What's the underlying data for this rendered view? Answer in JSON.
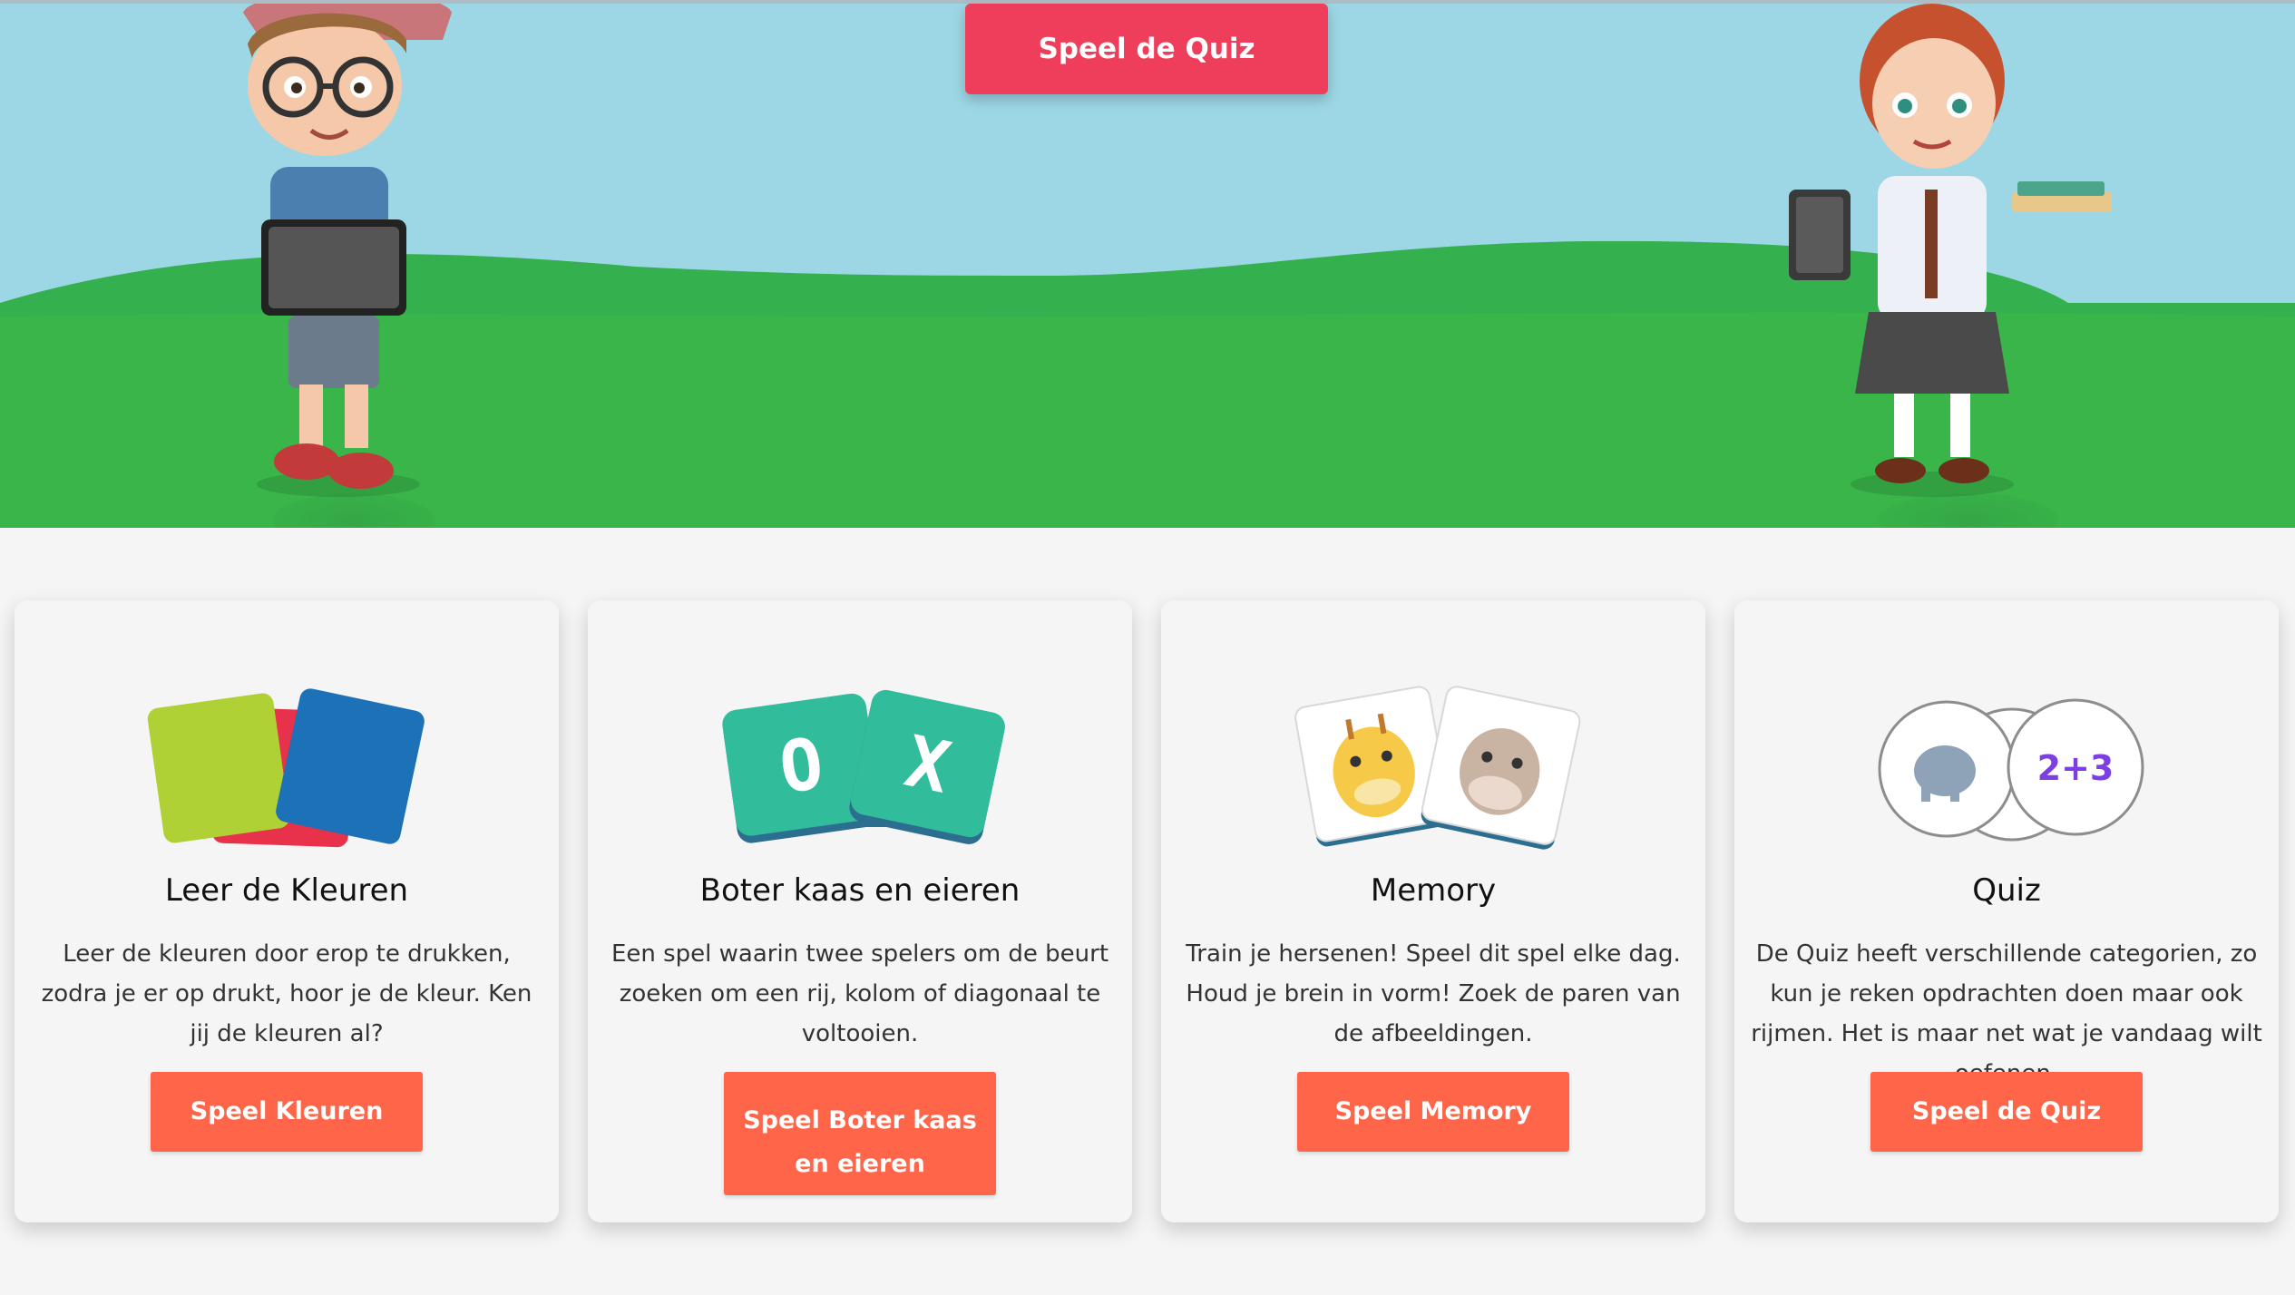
{
  "hero": {
    "cta_label": "Speel de Quiz",
    "colors": {
      "sky": "#9dd7e5",
      "grass_back": "#35b04e",
      "grass_front": "#39b54a",
      "cta": "#ef3e5c"
    }
  },
  "cards": [
    {
      "title": "Leer de Kleuren",
      "description": "Leer de kleuren door erop te drukken, zodra je er op drukt, hoor je de kleur. Ken jij de kleuren al?",
      "button": "Speel Kleuren",
      "icon": "color-cards-icon"
    },
    {
      "title": "Boter kaas en eieren",
      "description": "Een spel waarin twee spelers om de beurt zoeken om een rij, kolom of diagonaal te voltooien.",
      "button": "Speel Boter kaas en eieren",
      "icon": "tic-tac-toe-icon",
      "tiles": [
        "O",
        "X"
      ]
    },
    {
      "title": "Memory",
      "description": "Train je hersenen! Speel dit spel elke dag. Houd je brein in vorm! Zoek de paren van de afbeeldingen.",
      "button": "Speel Memory",
      "icon": "memory-cards-icon"
    },
    {
      "title": "Quiz",
      "description": "De Quiz heeft verschillende categorien, zo kun je reken opdrachten doen maar ook rijmen. Het is maar net wat je vandaag wilt oefenen.",
      "button": "Speel de Quiz",
      "icon": "quiz-circles-icon",
      "badge": "2+3"
    }
  ],
  "button_color": "#fe6549"
}
